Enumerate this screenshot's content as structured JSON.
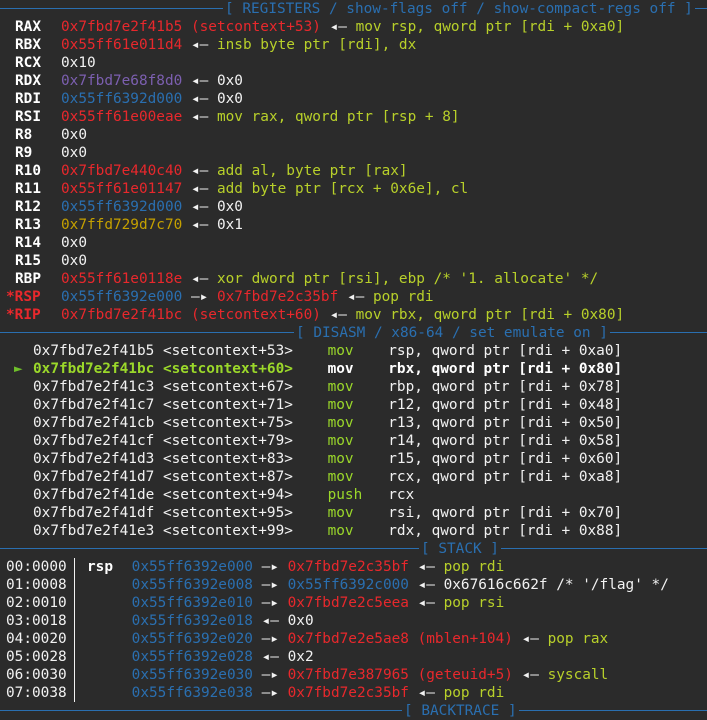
{
  "headers": {
    "registers": "[ REGISTERS / show-flags off / show-compact-regs off ]",
    "disasm": "[ DISASM / x86-64 / set emulate on ]",
    "stack": "[ STACK ]",
    "backtrace": "[ BACKTRACE ]"
  },
  "registers": [
    {
      "name": "RAX",
      "val": "0x7fbd7e2f41b5 (setcontext+53)",
      "arrow": "◂—",
      "rest": "mov rsp, qword ptr [rdi + 0xa0]"
    },
    {
      "name": "RBX",
      "val": "0x55ff61e011d4",
      "arrow": "◂—",
      "rest": "insb byte ptr [rdi], dx"
    },
    {
      "name": "RCX",
      "val": "0x10"
    },
    {
      "name": "RDX",
      "val": "0x7fbd7e68f8d0",
      "arrow": "◂—",
      "rest": "0x0"
    },
    {
      "name": "RDI",
      "val": "0x55ff6392d000",
      "arrow": "◂—",
      "rest": "0x0"
    },
    {
      "name": "RSI",
      "val": "0x55ff61e00eae",
      "arrow": "◂—",
      "rest": "mov rax, qword ptr [rsp + 8]"
    },
    {
      "name": "R8",
      "val": "0x0"
    },
    {
      "name": "R9",
      "val": "0x0"
    },
    {
      "name": "R10",
      "val": "0x7fbd7e440c40",
      "arrow": "◂—",
      "rest": "add al, byte ptr [rax]"
    },
    {
      "name": "R11",
      "val": "0x55ff61e01147",
      "arrow": "◂—",
      "rest": "add byte ptr [rcx + 0x6e], cl"
    },
    {
      "name": "R12",
      "val": "0x55ff6392d000",
      "arrow": "◂—",
      "rest": "0x0"
    },
    {
      "name": "R13",
      "val": "0x7ffd729d7c70",
      "arrow": "◂—",
      "rest": "0x1"
    },
    {
      "name": "R14",
      "val": "0x0"
    },
    {
      "name": "R15",
      "val": "0x0"
    },
    {
      "name": "RBP",
      "val": "0x55ff61e0118e",
      "arrow": "◂—",
      "rest": "xor dword ptr [rsi], ebp /* '1. allocate' */"
    },
    {
      "name": "*RSP",
      "val": "0x55ff6392e000",
      "arrow": "—▸",
      "val2": "0x7fbd7e2c35bf",
      "arrow2": "◂—",
      "rest": "pop rdi"
    },
    {
      "name": "*RIP",
      "val": "0x7fbd7e2f41bc (setcontext+60)",
      "arrow": "◂—",
      "rest": "mov rbx, qword ptr [rdi + 0x80]"
    }
  ],
  "disasm": [
    {
      "addr": "0x7fbd7e2f41b5",
      "sym": "<setcontext+53>",
      "mnem": "mov",
      "ops": "rsp, qword ptr [rdi + 0xa0]"
    },
    {
      "addr": "0x7fbd7e2f41bc",
      "sym": "<setcontext+60>",
      "mnem": "mov",
      "ops": "rbx, qword ptr [rdi + 0x80]",
      "current": true,
      "marker": "►"
    },
    {
      "addr": "0x7fbd7e2f41c3",
      "sym": "<setcontext+67>",
      "mnem": "mov",
      "ops": "rbp, qword ptr [rdi + 0x78]"
    },
    {
      "addr": "0x7fbd7e2f41c7",
      "sym": "<setcontext+71>",
      "mnem": "mov",
      "ops": "r12, qword ptr [rdi + 0x48]"
    },
    {
      "addr": "0x7fbd7e2f41cb",
      "sym": "<setcontext+75>",
      "mnem": "mov",
      "ops": "r13, qword ptr [rdi + 0x50]"
    },
    {
      "addr": "0x7fbd7e2f41cf",
      "sym": "<setcontext+79>",
      "mnem": "mov",
      "ops": "r14, qword ptr [rdi + 0x58]"
    },
    {
      "addr": "0x7fbd7e2f41d3",
      "sym": "<setcontext+83>",
      "mnem": "mov",
      "ops": "r15, qword ptr [rdi + 0x60]"
    },
    {
      "addr": "0x7fbd7e2f41d7",
      "sym": "<setcontext+87>",
      "mnem": "mov",
      "ops": "rcx, qword ptr [rdi + 0xa8]"
    },
    {
      "addr": "0x7fbd7e2f41de",
      "sym": "<setcontext+94>",
      "mnem": "push",
      "ops": "rcx"
    },
    {
      "addr": "0x7fbd7e2f41df",
      "sym": "<setcontext+95>",
      "mnem": "mov",
      "ops": "rsi, qword ptr [rdi + 0x70]"
    },
    {
      "addr": "0x7fbd7e2f41e3",
      "sym": "<setcontext+99>",
      "mnem": "mov",
      "ops": "rdx, qword ptr [rdi + 0x88]"
    }
  ],
  "stack": [
    {
      "off": "00:0000",
      "tag": "rsp",
      "addr": "0x55ff6392e000",
      "arrow": "—▸",
      "val": "0x7fbd7e2c35bf",
      "arrow2": "◂—",
      "rest": "pop rdi"
    },
    {
      "off": "01:0008",
      "tag": "",
      "addr": "0x55ff6392e008",
      "arrow": "—▸",
      "val": "0x55ff6392c000",
      "arrow2": "◂—",
      "rest": "0x67616c662f /* '/flag' */"
    },
    {
      "off": "02:0010",
      "tag": "",
      "addr": "0x55ff6392e010",
      "arrow": "—▸",
      "val": "0x7fbd7e2c5eea",
      "arrow2": "◂—",
      "rest": "pop rsi"
    },
    {
      "off": "03:0018",
      "tag": "",
      "addr": "0x55ff6392e018",
      "arrow": "◂—",
      "val": "0x0"
    },
    {
      "off": "04:0020",
      "tag": "",
      "addr": "0x55ff6392e020",
      "arrow": "—▸",
      "val": "0x7fbd7e2e5ae8 (mblen+104)",
      "arrow2": "◂—",
      "rest": "pop rax"
    },
    {
      "off": "05:0028",
      "tag": "",
      "addr": "0x55ff6392e028",
      "arrow": "◂—",
      "val": "0x2"
    },
    {
      "off": "06:0030",
      "tag": "",
      "addr": "0x55ff6392e030",
      "arrow": "—▸",
      "val": "0x7fbd7e387965 (geteuid+5)",
      "arrow2": "◂—",
      "rest": "syscall"
    },
    {
      "off": "07:0038",
      "tag": "",
      "addr": "0x55ff6392e038",
      "arrow": "—▸",
      "val": "0x7fbd7e2c35bf",
      "arrow2": "◂—",
      "rest": "pop rdi"
    }
  ]
}
